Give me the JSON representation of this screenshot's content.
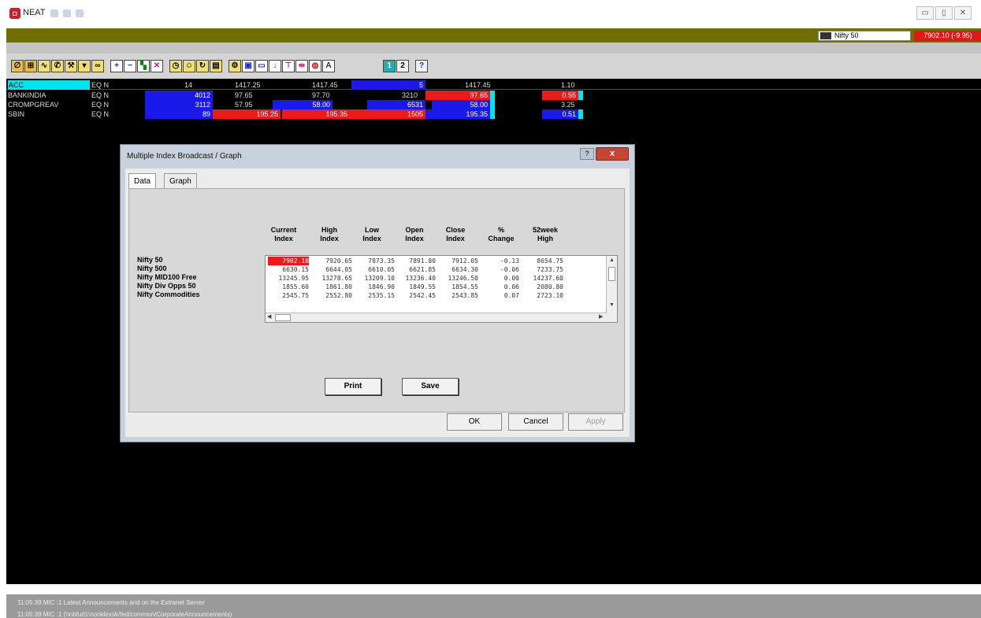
{
  "app": {
    "title": "NEAT"
  },
  "index_bar": {
    "selected_index": "Nifty 50",
    "value": "7902.10 (-9.95)"
  },
  "toolbar": {
    "pages": [
      "1",
      "2"
    ],
    "help": "?"
  },
  "market_watch": {
    "rows": [
      {
        "symbol": "ACC",
        "series": "EQ N",
        "buy_qty": "14",
        "buy_price": "1417.25",
        "sell_price": "1417.45",
        "sell_qty": "5",
        "ltp": "1417.45",
        "change": "1.10"
      },
      {
        "symbol": "BANKINDIA",
        "series": "EQ N",
        "buy_qty": "4012",
        "buy_price": "97.65",
        "sell_price": "97.70",
        "sell_qty": "3210",
        "ltp": "97.65",
        "change": "0.55"
      },
      {
        "symbol": "CROMPGREAV",
        "series": "EQ N",
        "buy_qty": "3112",
        "buy_price": "57.95",
        "sell_price": "58.00",
        "sell_qty": "6531",
        "ltp": "58.00",
        "change": "3.25"
      },
      {
        "symbol": "SBIN",
        "series": "EQ N",
        "buy_qty": "89",
        "buy_price": "195.25",
        "sell_price": "195.35",
        "sell_qty": "1505",
        "ltp": "195.35",
        "change": "0.51"
      }
    ]
  },
  "dialog": {
    "title": "Multiple Index Broadcast / Graph",
    "close": "x",
    "help": "?",
    "tabs": {
      "data": "Data",
      "graph": "Graph"
    },
    "columns": [
      [
        "Current",
        "Index"
      ],
      [
        "High",
        "Index"
      ],
      [
        "Low",
        "Index"
      ],
      [
        "Open",
        "Index"
      ],
      [
        "Close",
        "Index"
      ],
      [
        "%",
        "Change"
      ],
      [
        "52week",
        "High"
      ]
    ],
    "index_names": [
      "Nifty 50",
      "Nifty 500",
      "Nifty MID100 Free",
      "Nifty Div Opps 50",
      "Nifty Commodities"
    ],
    "rows": [
      [
        "7902.10",
        "7920.65",
        "7873.35",
        "7891.80",
        "7912.05",
        "-0.13",
        "8654.75"
      ],
      [
        "6630.15",
        "6644.05",
        "6610.05",
        "6621.85",
        "6634.30",
        "-0.06",
        "7233.75"
      ],
      [
        "13245.95",
        "13278.65",
        "13209.10",
        "13236.40",
        "13246.50",
        "0.00",
        "14237.60"
      ],
      [
        "1855.60",
        "1861.80",
        "1846.90",
        "1849.55",
        "1854.55",
        "0.06",
        "2080.80"
      ],
      [
        "2545.75",
        "2552.80",
        "2535.15",
        "2542.45",
        "2543.85",
        "0.07",
        "2723.10"
      ]
    ],
    "print_button": "Print",
    "save_button": "Save",
    "ok_button": "OK",
    "cancel_button": "Cancel",
    "apply_button": "Apply"
  },
  "status_bar": {
    "messages": [
      "11:05:39  MIC :1  Latest Announcements and on the Extranet Server",
      "11:05:39  MIC :1  (\\\\nbfurl1\\nonklexsk/fed/common/CorporateAnnouncements)"
    ]
  }
}
